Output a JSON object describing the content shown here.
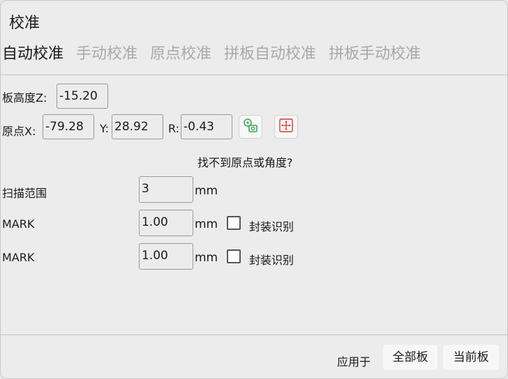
{
  "dialog": {
    "title": "校准"
  },
  "tabs": [
    {
      "label": "自动校准",
      "active": true
    },
    {
      "label": "手动校准",
      "active": false
    },
    {
      "label": "原点校准",
      "active": false
    },
    {
      "label": "拼板自动校准",
      "active": false
    },
    {
      "label": "拼板手动校准",
      "active": false
    }
  ],
  "board_height": {
    "label": "板高度Z:",
    "value": "-15.20"
  },
  "origin": {
    "x_label": "原点X:",
    "x_value": "-79.28",
    "y_label": "Y:",
    "y_value": "28.92",
    "r_label": "R:",
    "r_value": "-0.43",
    "locate_icon": "camera-locate-icon",
    "move_icon": "move-to-origin-icon"
  },
  "hint": "找不到原点或角度?",
  "scan_range": {
    "label": "扫描范围",
    "value": "3",
    "unit": "mm"
  },
  "mark1": {
    "label": "MARK",
    "value": "1.00",
    "unit": "mm",
    "checkbox_label": "封装识别",
    "checked": false
  },
  "mark2": {
    "label": "MARK",
    "value": "1.00",
    "unit": "mm",
    "checkbox_label": "封装识别",
    "checked": false
  },
  "footer": {
    "apply_label": "应用于",
    "all_boards": "全部板",
    "current_board": "当前板"
  },
  "colors": {
    "locate_icon": "#3aa655",
    "move_icon": "#d23a3a",
    "inactive_tab": "#a9a9a9"
  }
}
